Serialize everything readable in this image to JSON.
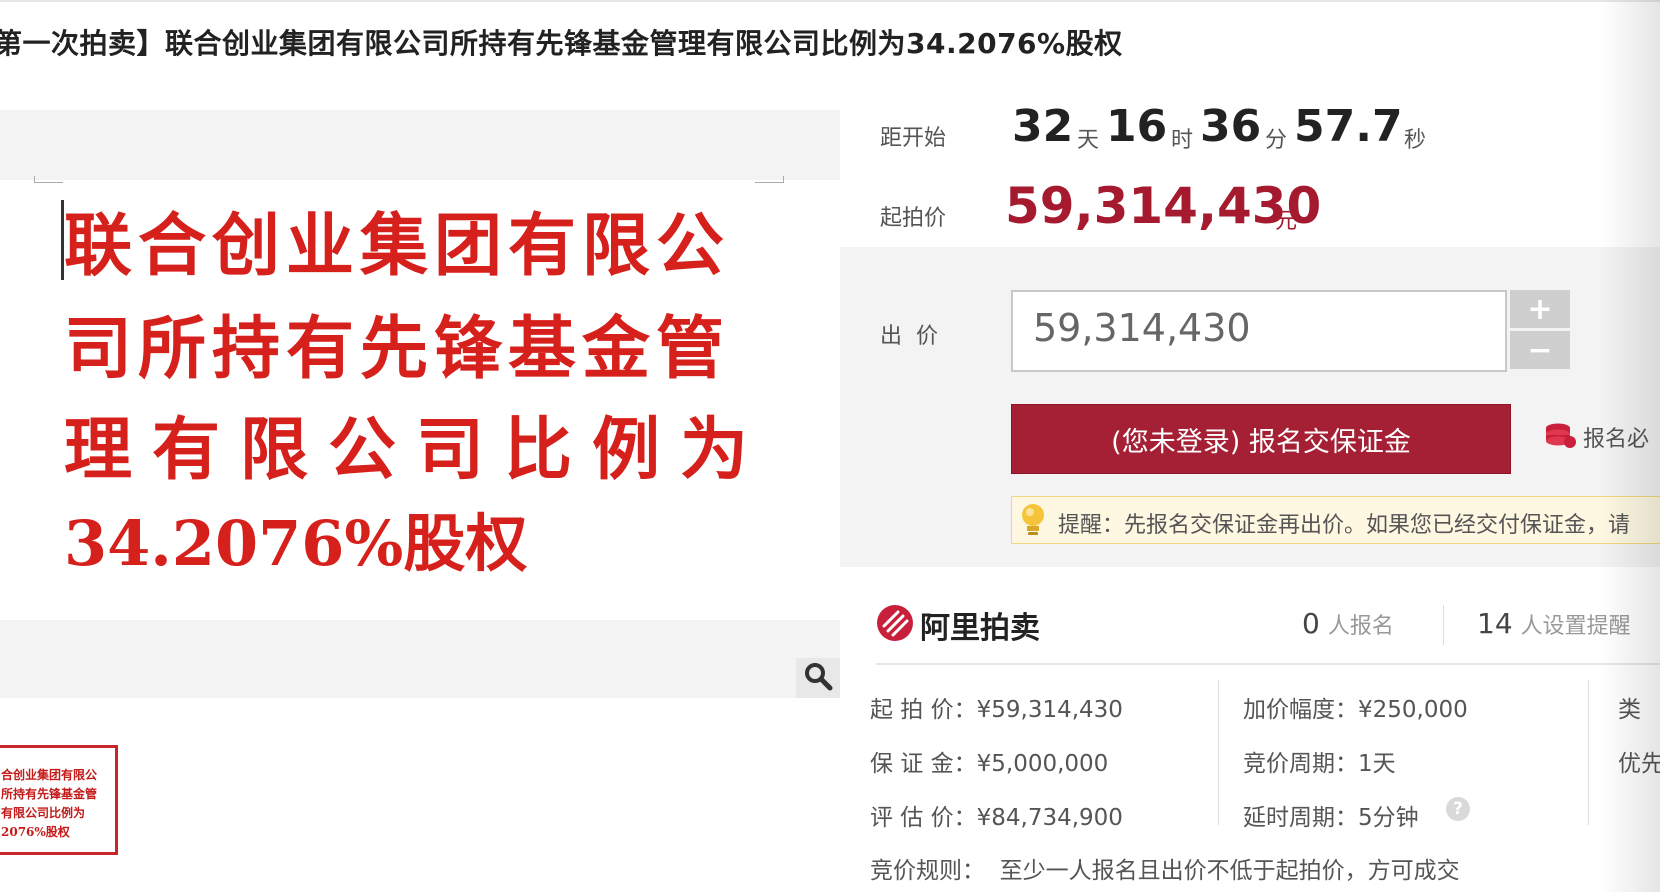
{
  "title": "第一次拍卖】联合创业集团有限公司所持有先锋基金管理有限公司比例为34.2076%股权",
  "gallery": {
    "doc_lines": [
      "联合创业集团有限公",
      "司所持有先锋基金管",
      "理有限公司比例为",
      "34.2076%股权"
    ],
    "thumb_lines": [
      "合创业集团有限公",
      "所持有先锋基金管",
      "有限公司比例为",
      "2076%股权"
    ],
    "zoom_icon": "magnifier-icon"
  },
  "countdown": {
    "label": "距开始",
    "days": "32",
    "days_unit": "天",
    "hours": "16",
    "hours_unit": "时",
    "minutes": "36",
    "minutes_unit": "分",
    "seconds": "57.7",
    "seconds_unit": "秒"
  },
  "start_price": {
    "label": "起拍价",
    "value": "59,314,430",
    "unit": "元"
  },
  "bid": {
    "label": "出  价",
    "input_value": "59,314,430",
    "plus": "+",
    "minus": "−",
    "register_button": "(您未登录) 报名交保证金",
    "must_read": "报名必",
    "reminder": "提醒：先报名交保证金再出价。如果您已经交付保证金，请"
  },
  "platform": {
    "name": "阿里拍卖",
    "registered_count": "0",
    "registered_unit": "人报名",
    "reminder_count": "14",
    "reminder_unit": "人设置提醒"
  },
  "details": {
    "start_price": "起 拍 价：¥59,314,430",
    "increment": "加价幅度：¥250,000",
    "category": "类",
    "deposit": "保 证 金：¥5,000,000",
    "cycle": "竞价周期：1天",
    "priority": "优先",
    "appraisal": "评 估 价：¥84,734,900",
    "delay": "延时周期：5分钟",
    "rules": "竞价规则：  至少一人报名且出价不低于起拍价，方可成交"
  },
  "colors": {
    "accent": "#a51f35",
    "doc_red": "#d6201c",
    "panel_bg": "#f3f3f3"
  }
}
